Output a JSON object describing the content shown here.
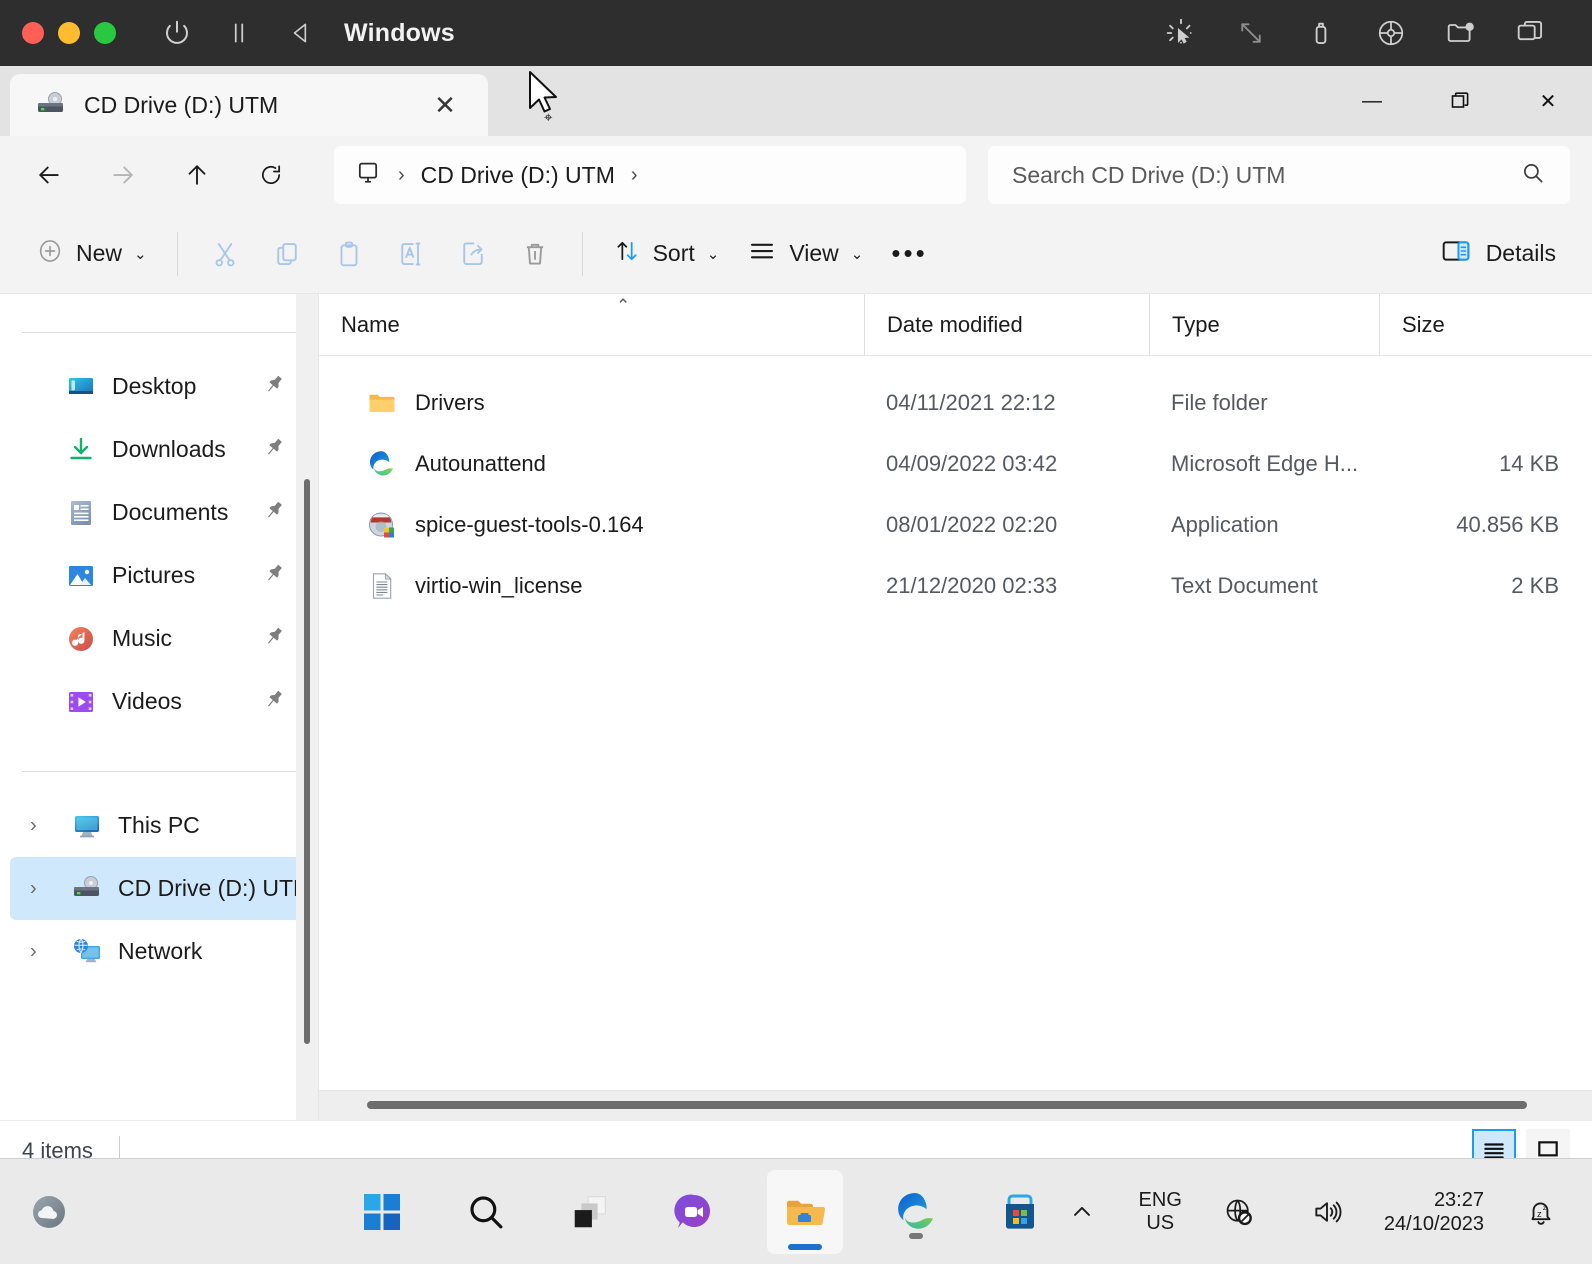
{
  "host": {
    "title": "Windows",
    "traffic_lights": [
      "close",
      "minimize",
      "zoom"
    ],
    "controls": [
      {
        "name": "power-icon"
      },
      {
        "name": "pause-icon"
      },
      {
        "name": "back-triangle-icon"
      }
    ],
    "right_controls": [
      {
        "name": "cursor-capture-icon"
      },
      {
        "name": "resize-arrows-icon"
      },
      {
        "name": "usb-icon"
      },
      {
        "name": "disc-icon"
      },
      {
        "name": "shared-folder-icon"
      },
      {
        "name": "windows-stack-icon"
      }
    ]
  },
  "window": {
    "tab": {
      "label": "CD Drive (D:) UTM",
      "icon": "cd-drive-icon",
      "close_label": "✕"
    },
    "controls": {
      "minimize": "—",
      "maximize": "❐",
      "close": "✕"
    }
  },
  "nav": {
    "back": "back-arrow-icon",
    "forward": "forward-arrow-icon",
    "up": "up-arrow-icon",
    "refresh": "refresh-icon",
    "breadcrumb": {
      "root_icon": "this-pc-icon",
      "items": [
        "CD Drive (D:) UTM"
      ],
      "separator": "›"
    }
  },
  "search": {
    "placeholder": "Search CD Drive (D:) UTM",
    "icon": "search-icon"
  },
  "toolbar": {
    "new_label": "New",
    "new_icon": "plus-circle-icon",
    "actions": [
      {
        "name": "cut-icon",
        "label": "Cut"
      },
      {
        "name": "copy-icon",
        "label": "Copy"
      },
      {
        "name": "paste-icon",
        "label": "Paste"
      },
      {
        "name": "rename-icon",
        "label": "Rename"
      },
      {
        "name": "share-icon",
        "label": "Share"
      },
      {
        "name": "delete-icon",
        "label": "Delete"
      }
    ],
    "sort_label": "Sort",
    "view_label": "View",
    "more_label": "•••",
    "details_label": "Details",
    "details_icon": "details-pane-icon"
  },
  "sidebar": {
    "quick_access": [
      {
        "label": "Desktop",
        "icon": "desktop-icon",
        "pinned": true
      },
      {
        "label": "Downloads",
        "icon": "downloads-icon",
        "pinned": true
      },
      {
        "label": "Documents",
        "icon": "documents-icon",
        "pinned": true
      },
      {
        "label": "Pictures",
        "icon": "pictures-icon",
        "pinned": true
      },
      {
        "label": "Music",
        "icon": "music-icon",
        "pinned": true
      },
      {
        "label": "Videos",
        "icon": "videos-icon",
        "pinned": true
      }
    ],
    "tree": [
      {
        "label": "This PC",
        "icon": "this-pc-icon",
        "selected": false
      },
      {
        "label": "CD Drive (D:) UTM",
        "icon": "cd-drive-icon",
        "selected": true
      },
      {
        "label": "Network",
        "icon": "network-icon",
        "selected": false
      }
    ],
    "expander_glyph": "›"
  },
  "filelist": {
    "columns": [
      "Name",
      "Date modified",
      "Type",
      "Size"
    ],
    "sort_column": "Name",
    "sort_direction": "ascending",
    "rows": [
      {
        "name": "Drivers",
        "date": "04/11/2021 22:12",
        "type": "File folder",
        "size": "",
        "icon": "folder-icon"
      },
      {
        "name": "Autounattend",
        "date": "04/09/2022 03:42",
        "type": "Microsoft Edge H...",
        "size": "14 KB",
        "icon": "edge-icon"
      },
      {
        "name": "spice-guest-tools-0.164",
        "date": "08/01/2022 02:20",
        "type": "Application",
        "size": "40.856 KB",
        "icon": "application-icon"
      },
      {
        "name": "virtio-win_license",
        "date": "21/12/2020 02:33",
        "type": "Text Document",
        "size": "2 KB",
        "icon": "text-document-icon"
      }
    ]
  },
  "statusbar": {
    "item_count": "4 items",
    "view_toggles": [
      {
        "name": "details-view-toggle",
        "selected": true
      },
      {
        "name": "large-icons-view-toggle",
        "selected": false
      }
    ]
  },
  "taskbar": {
    "weather_icon": "weather-cloud-icon",
    "items": [
      {
        "name": "start-button",
        "icon": "windows-logo-icon",
        "active": false
      },
      {
        "name": "search-taskbar-button",
        "icon": "search-icon",
        "active": false
      },
      {
        "name": "task-view-button",
        "icon": "task-view-icon",
        "active": false
      },
      {
        "name": "chat-button",
        "icon": "chat-camera-icon",
        "active": false
      },
      {
        "name": "file-explorer-button",
        "icon": "file-explorer-icon",
        "active": true
      },
      {
        "name": "edge-button",
        "icon": "edge-icon",
        "active": false,
        "running": true
      },
      {
        "name": "microsoft-store-button",
        "icon": "store-icon",
        "active": false
      }
    ],
    "tray": {
      "overflow_glyph": "⌃",
      "language_primary": "ENG",
      "language_secondary": "US",
      "network_icon": "network-disconnected-icon",
      "volume_icon": "volume-icon",
      "time": "23:27",
      "date": "24/10/2023",
      "notification_icon": "notifications-silent-icon"
    }
  },
  "colors": {
    "accent": "#1a9cf0",
    "selection": "#cfe8fc",
    "host_bar": "#2e2e2e",
    "chrome": "#f3f3f3"
  }
}
